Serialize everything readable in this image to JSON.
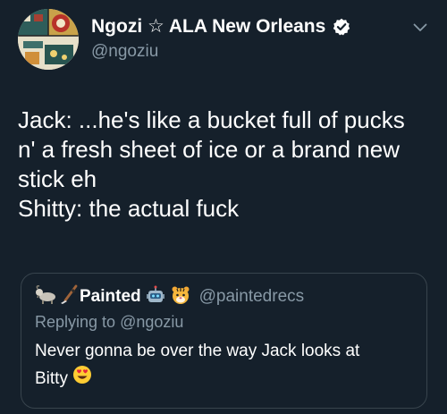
{
  "author": {
    "display_name": "Ngozi ☆ ALA New Orleans",
    "handle": "@ngoziu"
  },
  "tweet": {
    "lines": [
      "Jack: ...he's like a bucket full of pucks",
      "n' a fresh sheet of ice or a brand new",
      "stick eh",
      "Shitty: the actual fuck"
    ]
  },
  "quoted": {
    "display_name": "Painted",
    "handle": "@paintedrecs",
    "reply_prefix": "Replying to ",
    "reply_handle": "@ngoziu",
    "text_line1": "Never gonna be over the way Jack looks at",
    "text_line2": "Bitty"
  },
  "icons": {
    "verified": "verified-badge-icon",
    "chevron": "chevron-down-icon",
    "emoji_goat": "goat-emoji-icon",
    "emoji_hockey": "hockey-stick-emoji-icon",
    "emoji_robot": "robot-emoji-icon",
    "emoji_tiger": "tiger-face-emoji-icon",
    "emoji_heart_eyes": "heart-eyes-emoji-icon"
  },
  "colors": {
    "background": "#15202b",
    "text_primary": "#ffffff",
    "text_secondary": "#8899a6",
    "link": "#8899a6",
    "border": "#38444d"
  }
}
